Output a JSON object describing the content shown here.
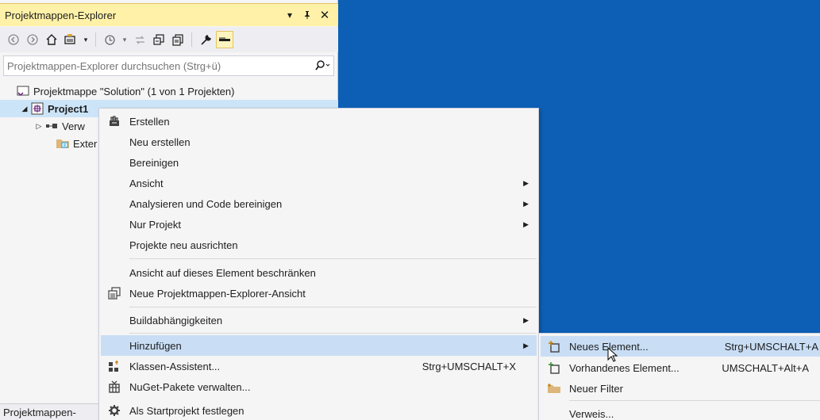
{
  "panel": {
    "title": "Projektmappen-Explorer",
    "pin_glyph": "▾",
    "autohide_glyph": "ᛘ",
    "close_glyph": "✕",
    "search_placeholder": "Projektmappen-Explorer durchsuchen (Strg+ü)",
    "status_label": "Projektmappen-"
  },
  "tree": {
    "solution": "Projektmappe \"Solution\" (1 von 1 Projekten)",
    "project": "Project1",
    "references": "Verw",
    "external": "Exter"
  },
  "context_menu": {
    "items": [
      {
        "label": "Erstellen"
      },
      {
        "label": "Neu erstellen"
      },
      {
        "label": "Bereinigen"
      },
      {
        "label": "Ansicht"
      },
      {
        "label": "Analysieren und Code bereinigen"
      },
      {
        "label": "Nur Projekt"
      },
      {
        "label": "Projekte neu ausrichten"
      },
      {
        "label": "Ansicht auf dieses Element beschränken"
      },
      {
        "label": "Neue Projektmappen-Explorer-Ansicht"
      },
      {
        "label": "Buildabhängigkeiten"
      },
      {
        "label": "Hinzufügen"
      },
      {
        "label": "Klassen-Assistent...",
        "shortcut": "Strg+UMSCHALT+X"
      },
      {
        "label": "NuGet-Pakete verwalten..."
      },
      {
        "label": "Als Startprojekt festlegen"
      }
    ]
  },
  "submenu": {
    "items": [
      {
        "label": "Neues Element...",
        "shortcut": "Strg+UMSCHALT+A"
      },
      {
        "label": "Vorhandenes Element...",
        "shortcut": "UMSCHALT+Alt+A"
      },
      {
        "label": "Neuer Filter"
      },
      {
        "label": "Verweis..."
      }
    ]
  },
  "colors": {
    "background": "#0d5fb6",
    "title_bar": "#fff1a8",
    "menu_hover": "#c9def5",
    "selection": "#cce4f7"
  },
  "icons": [
    "back-icon",
    "forward-icon",
    "home-icon",
    "switch-views-icon",
    "history-icon",
    "sync-icon",
    "collapse-icon",
    "show-all-files-icon",
    "properties-icon",
    "preview-icon",
    "search-icon",
    "build-icon",
    "new-view-icon",
    "class-wizard-icon",
    "nuget-icon",
    "settings-icon",
    "new-item-icon",
    "existing-item-icon",
    "filter-icon"
  ]
}
